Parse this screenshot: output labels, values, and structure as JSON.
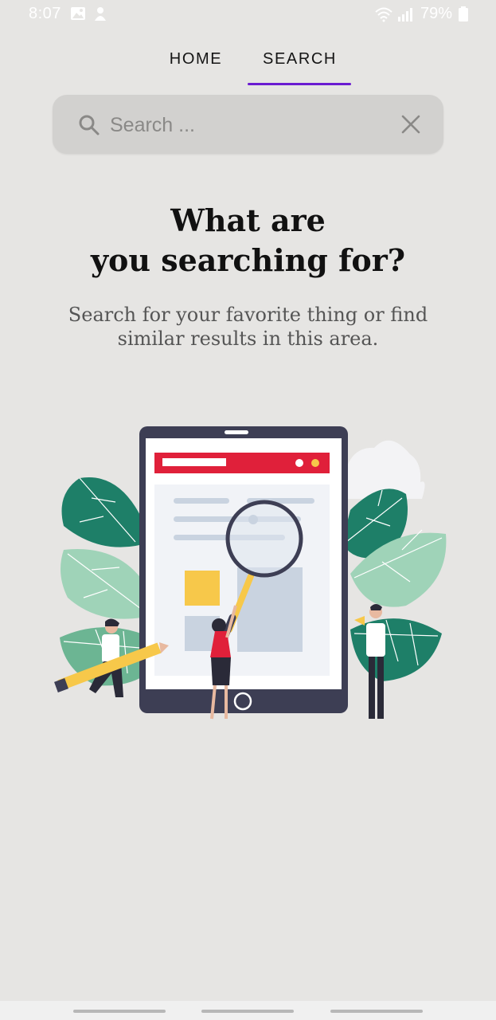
{
  "status_bar": {
    "time": "8:07",
    "battery": "79%",
    "icons": [
      "image-icon",
      "notification-icon",
      "wifi-icon",
      "signal-icon",
      "battery-icon"
    ]
  },
  "tabs": [
    {
      "label": "HOME",
      "active": false
    },
    {
      "label": "SEARCH",
      "active": true
    }
  ],
  "search": {
    "placeholder": "Search ...",
    "value": "",
    "icon": "search-icon",
    "clear_icon": "close-icon"
  },
  "empty_state": {
    "title_line1": "What are",
    "title_line2": "you searching for?",
    "subtitle_line1": "Search for your favorite thing or find",
    "subtitle_line2": "similar results in this area."
  },
  "colors": {
    "accent": "#6a1bd1",
    "background": "#e6e5e3",
    "search_bg": "#d2d1cf",
    "illustration_red": "#e0203a",
    "illustration_dark": "#3d3e54",
    "leaf_dark": "#1e7f68",
    "leaf_light": "#9fd3b8",
    "yellow": "#f7c84a"
  }
}
